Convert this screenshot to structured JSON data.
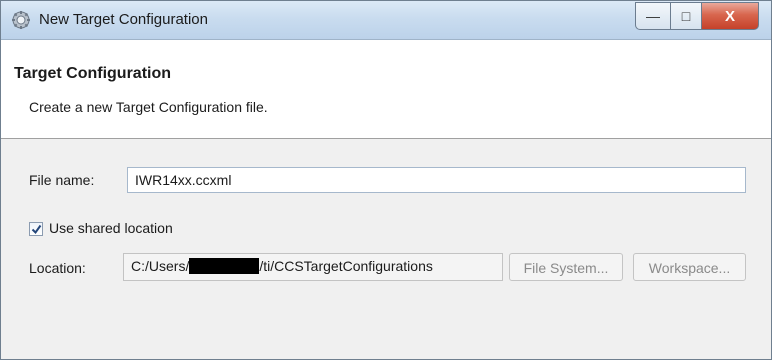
{
  "window": {
    "title": "New Target Configuration"
  },
  "caption_buttons": {
    "minimize": "—",
    "maximize": "□",
    "close": "X"
  },
  "banner": {
    "title": "Target Configuration",
    "description": "Create a new Target Configuration file."
  },
  "form": {
    "file_name_label": "File name:",
    "file_name_value": "IWR14xx.ccxml",
    "shared_checkbox_label": "Use shared location",
    "shared_checked": true,
    "location_label": "Location:",
    "location_prefix": "C:/Users/",
    "location_suffix": "/ti/CCSTargetConfigurations",
    "file_system_button": "File System...",
    "workspace_button": "Workspace..."
  }
}
